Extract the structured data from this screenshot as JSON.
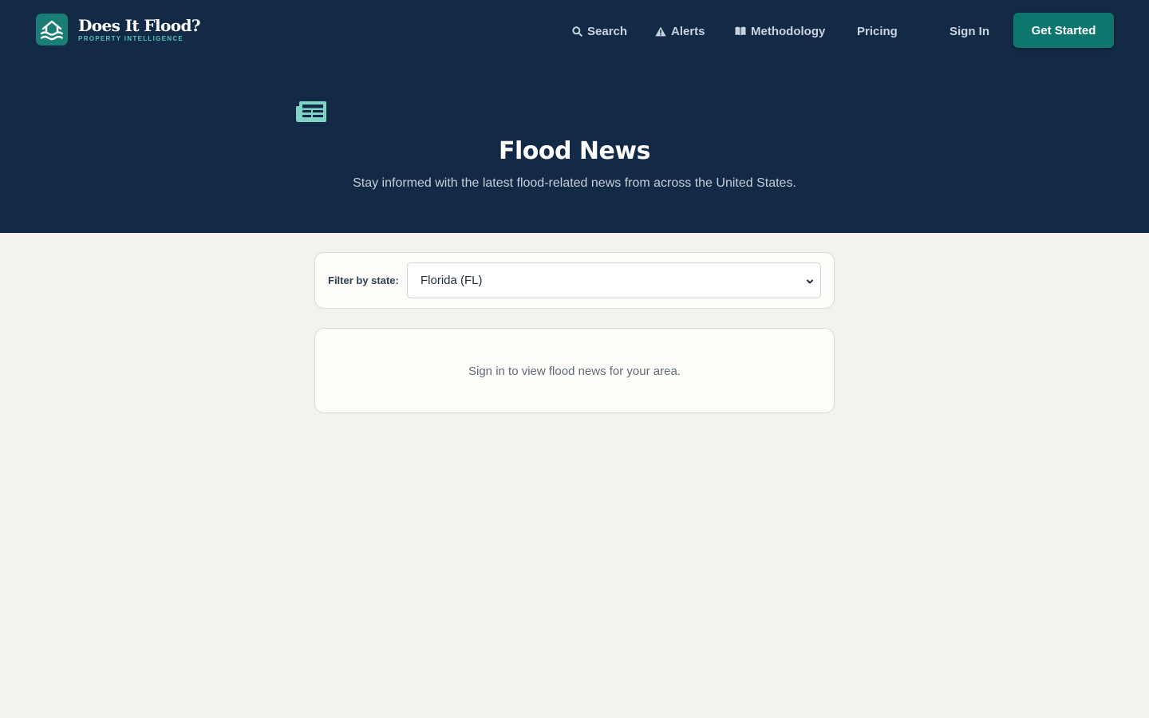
{
  "brand": {
    "name": "Does It Flood?",
    "tagline": "PROPERTY INTELLIGENCE",
    "logo_icon": "house-waves-icon"
  },
  "nav": {
    "search": {
      "label": "Search",
      "icon": "search-icon"
    },
    "alerts": {
      "label": "Alerts",
      "icon": "warning-icon"
    },
    "methodology": {
      "label": "Methodology",
      "icon": "book-icon"
    },
    "pricing": {
      "label": "Pricing"
    },
    "sign_in": {
      "label": "Sign In"
    },
    "get_started": {
      "label": "Get Started"
    }
  },
  "hero": {
    "icon": "newspaper-icon",
    "title": "Flood News",
    "subtitle": "Stay informed with the latest flood-related news from across the United States."
  },
  "filter": {
    "label": "Filter by state:",
    "selected": "Florida (FL)"
  },
  "message": {
    "text": "Sign in to view flood news for your area."
  },
  "colors": {
    "header_bg": "#122a45",
    "accent": "#0f766e",
    "icon_teal": "#57c3b6",
    "page_bg": "#f3f2ee",
    "card_bg": "#fefdf9"
  }
}
